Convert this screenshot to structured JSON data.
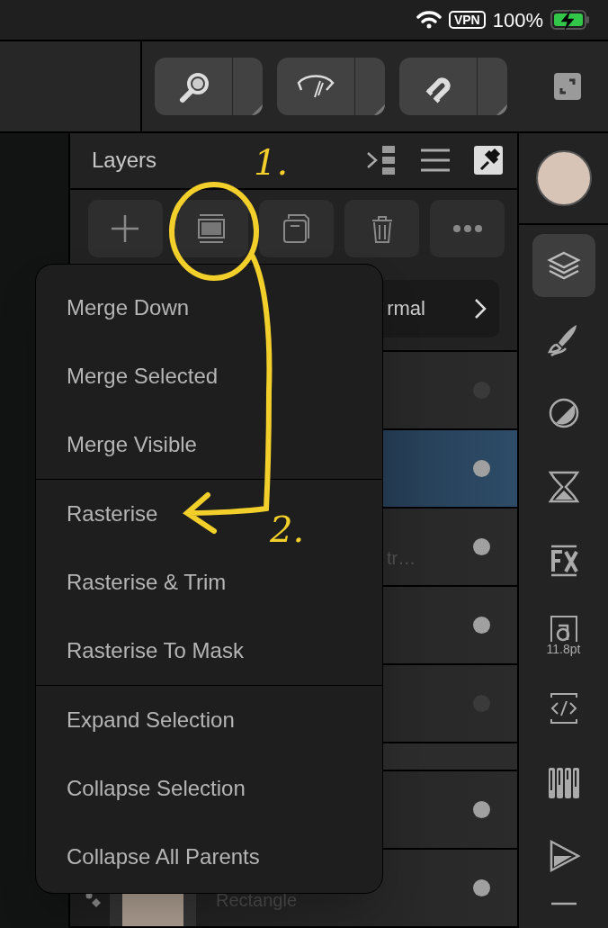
{
  "status_bar": {
    "vpn": "VPN",
    "battery": "100%",
    "charging": true
  },
  "toolbar": {
    "tools": [
      {
        "kind": "zoom"
      },
      {
        "kind": "view"
      },
      {
        "kind": "snap"
      }
    ]
  },
  "layers_panel": {
    "title": "Layers",
    "pinned": true,
    "actions": [
      {
        "kind": "add"
      },
      {
        "kind": "rasterise"
      },
      {
        "kind": "group"
      },
      {
        "kind": "delete"
      },
      {
        "kind": "more"
      }
    ],
    "blend_mode": "rmal",
    "rows": [
      {
        "kind": "layer",
        "visible": false,
        "selected": false
      },
      {
        "kind": "layer",
        "visible": true,
        "selected": true
      },
      {
        "kind": "layer",
        "visible": true,
        "selected": false,
        "name": "tr…"
      },
      {
        "kind": "layer",
        "visible": true,
        "selected": false
      },
      {
        "kind": "layer",
        "visible": false,
        "selected": false
      },
      {
        "kind": "header"
      },
      {
        "kind": "layer",
        "visible": true,
        "selected": false
      },
      {
        "kind": "shape",
        "visible": true,
        "selected": false,
        "name": "Rectangle"
      }
    ]
  },
  "context_menu": {
    "sections": [
      [
        "Merge Down",
        "Merge Selected",
        "Merge Visible"
      ],
      [
        "Rasterise",
        "Rasterise & Trim",
        "Rasterise To Mask"
      ],
      [
        "Expand Selection",
        "Collapse Selection",
        "Collapse All Parents"
      ]
    ]
  },
  "side_toolbar": {
    "color": "#d8c4b6",
    "tools": [
      {
        "kind": "layers",
        "selected": true
      },
      {
        "kind": "brush",
        "selected": false
      },
      {
        "kind": "adjust",
        "selected": false
      },
      {
        "kind": "time",
        "selected": false
      },
      {
        "kind": "fx",
        "selected": false
      },
      {
        "kind": "text",
        "selected": false,
        "caption": "11.8pt"
      },
      {
        "kind": "code",
        "selected": false
      },
      {
        "kind": "sliders",
        "selected": false
      },
      {
        "kind": "play",
        "selected": false
      },
      {
        "kind": "align"
      }
    ]
  },
  "annotations": [
    "1.",
    "2."
  ]
}
